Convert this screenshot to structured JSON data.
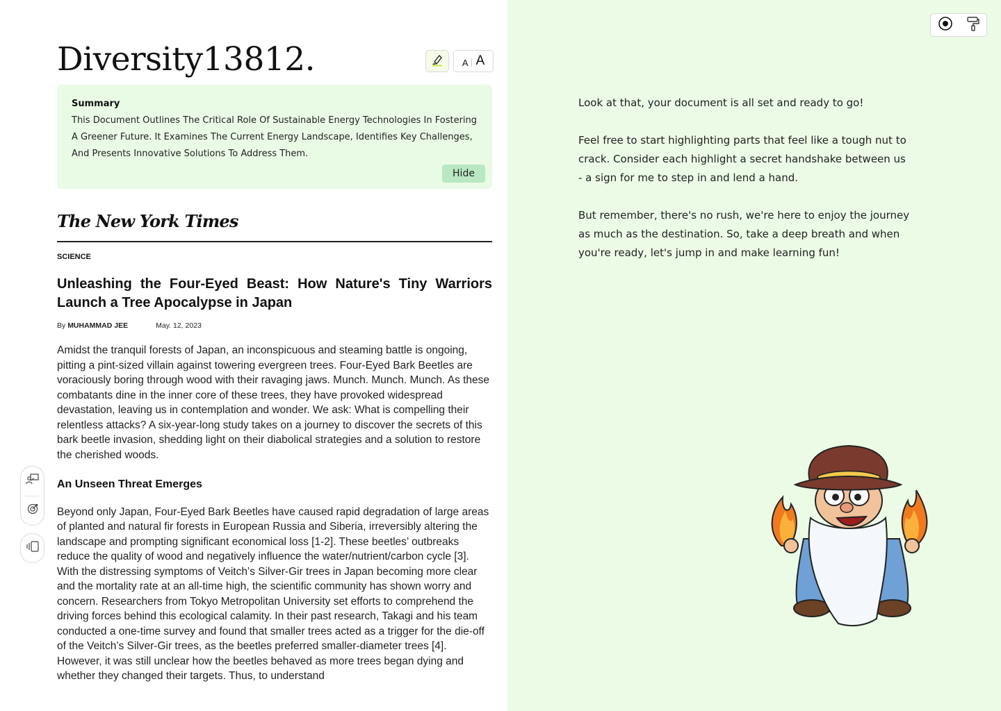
{
  "document": {
    "title": "Diversity13812.",
    "font_size_small": "A",
    "font_size_large": "A",
    "summary": {
      "label": "Summary",
      "text": "This Document Outlines The Critical Role Of Sustainable Energy Technologies In Fostering A Greener Future. It Examines The Current Energy Landscape, Identifies Key Challenges, And Presents Innovative Solutions To Address Them.",
      "hide_label": "Hide"
    }
  },
  "article": {
    "publication": "The New York Times",
    "section": "SCIENCE",
    "headline": "Unleashing the Four-Eyed Beast: How Nature's Tiny Warriors Launch a Tree Apocalypse in Japan",
    "byline_prefix": "By",
    "author": "MUHAMMAD JEE",
    "date": "May. 12, 2023",
    "paragraph_1": "Amidst the tranquil forests of Japan, an inconspicuous and steaming battle is ongoing, pitting a pint-sized villain against towering evergreen trees. Four-Eyed Bark Beetles are voraciously boring through wood with their ravaging jaws. Munch. Munch. Munch. As these combatants dine in the inner core of these trees, they have provoked widespread devastation, leaving us in contemplation and wonder. We ask: What is compelling their relentless attacks? A six-year-long study takes on a journey to discover the secrets of this bark beetle invasion, shedding light on their diabolical strategies and a solution to restore the cherished woods.",
    "subheading": "An Unseen Threat Emerges",
    "paragraph_2": "Beyond only Japan, Four-Eyed Bark Beetles have caused rapid degradation of large areas of planted and natural fir forests in European Russia and Siberia, irreversibly altering the landscape and prompting significant economical loss  [1-2]. These beetles’ outbreaks reduce the quality of wood and negatively influence the water/nutrient/carbon cycle [3]. With the distressing symptoms of Veitch’s Silver-Gir trees in Japan becoming more clear and the mortality rate at an all-time high, the scientific community has shown worry and concern. Researchers from Tokyo Metropolitan University set efforts to comprehend the driving forces behind this ecological calamity. In their past research, Takagi and his team conducted a one-time survey and found that smaller trees acted as a trigger for the die-off of the Veitch’s Silver-Gir trees, as the beetles preferred smaller-diameter trees [4]. However, it was still unclear how the beetles behaved as more trees began dying and whether they changed their targets. Thus, to understand"
  },
  "chat": {
    "messages": [
      "Look at that, your document is all set and ready to go!",
      "Feel free to start highlighting parts that feel like a tough nut to crack. Consider each highlight a secret handshake between us - a sign for me to step in and lend a hand.",
      "But remember, there's no rush, we're here to enjoy the journey as much as the destination. So, take a deep breath and when you're ready, let's jump in and make learning fun!"
    ]
  },
  "icons": {
    "highlighter": "highlighter-icon",
    "record": "record-icon",
    "paint_roller": "paint-roller-icon",
    "presenter": "presenter-icon",
    "target": "target-icon",
    "sidebar": "sidebar-toggle-icon"
  },
  "colors": {
    "chat_background": "#ebfbe6",
    "summary_background": "#eafbe5",
    "hide_button": "#b9e8c3",
    "highlighter_accent": "#c8e64a"
  }
}
